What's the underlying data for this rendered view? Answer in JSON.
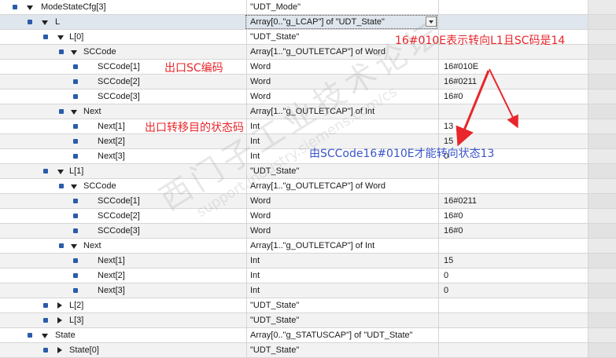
{
  "rows": [
    {
      "name": "ModeStateCfg[3]",
      "type": "\"UDT_Mode\"",
      "value": "",
      "level": 0,
      "exp": "down"
    },
    {
      "name": "L",
      "type": "Array[0..\"g_LCAP\"] of \"UDT_State\"",
      "value": "",
      "level": 1,
      "exp": "down",
      "dropdown": true,
      "focused": true
    },
    {
      "name": "L[0]",
      "type": "\"UDT_State\"",
      "value": "",
      "level": 2,
      "exp": "down"
    },
    {
      "name": "SCCode",
      "type": "Array[1..\"g_OUTLETCAP\"] of Word",
      "value": "",
      "level": 3,
      "exp": "down"
    },
    {
      "name": "SCCode[1]",
      "type": "Word",
      "value": "16#010E",
      "level": 4,
      "exp": ""
    },
    {
      "name": "SCCode[2]",
      "type": "Word",
      "value": "16#0211",
      "level": 4,
      "exp": ""
    },
    {
      "name": "SCCode[3]",
      "type": "Word",
      "value": "16#0",
      "level": 4,
      "exp": ""
    },
    {
      "name": "Next",
      "type": "Array[1..\"g_OUTLETCAP\"] of Int",
      "value": "",
      "level": 3,
      "exp": "down"
    },
    {
      "name": "Next[1]",
      "type": "Int",
      "value": "13",
      "level": 4,
      "exp": ""
    },
    {
      "name": "Next[2]",
      "type": "Int",
      "value": "15",
      "level": 4,
      "exp": ""
    },
    {
      "name": "Next[3]",
      "type": "Int",
      "value": "0",
      "level": 4,
      "exp": ""
    },
    {
      "name": "L[1]",
      "type": "\"UDT_State\"",
      "value": "",
      "level": 2,
      "exp": "down"
    },
    {
      "name": "SCCode",
      "type": "Array[1..\"g_OUTLETCAP\"] of Word",
      "value": "",
      "level": 3,
      "exp": "down"
    },
    {
      "name": "SCCode[1]",
      "type": "Word",
      "value": "16#0211",
      "level": 4,
      "exp": ""
    },
    {
      "name": "SCCode[2]",
      "type": "Word",
      "value": "16#0",
      "level": 4,
      "exp": ""
    },
    {
      "name": "SCCode[3]",
      "type": "Word",
      "value": "16#0",
      "level": 4,
      "exp": ""
    },
    {
      "name": "Next",
      "type": "Array[1..\"g_OUTLETCAP\"] of Int",
      "value": "",
      "level": 3,
      "exp": "down"
    },
    {
      "name": "Next[1]",
      "type": "Int",
      "value": "15",
      "level": 4,
      "exp": ""
    },
    {
      "name": "Next[2]",
      "type": "Int",
      "value": "0",
      "level": 4,
      "exp": ""
    },
    {
      "name": "Next[3]",
      "type": "Int",
      "value": "0",
      "level": 4,
      "exp": ""
    },
    {
      "name": "L[2]",
      "type": "\"UDT_State\"",
      "value": "",
      "level": 2,
      "exp": "right"
    },
    {
      "name": "L[3]",
      "type": "\"UDT_State\"",
      "value": "",
      "level": 2,
      "exp": "right"
    },
    {
      "name": "State",
      "type": "Array[0..\"g_STATUSCAP\"] of \"UDT_State\"",
      "value": "",
      "level": 1,
      "exp": "down"
    },
    {
      "name": "State[0]",
      "type": "\"UDT_State\"",
      "value": "",
      "level": 2,
      "exp": "right"
    }
  ],
  "annotations": {
    "top_note": "16#010E表示转向L1且SC码是14",
    "sc_note": "出口SC编码",
    "next_note": "出口转移目的状态码",
    "bottom_note": "由SCCode16#010E才能转向状态13",
    "colors": {
      "red": "#e8262b",
      "blue": "#3b55c9"
    }
  },
  "watermark": {
    "line1": "西门子工业技术论坛",
    "line2": "support.industry.siemens.com/cs"
  }
}
